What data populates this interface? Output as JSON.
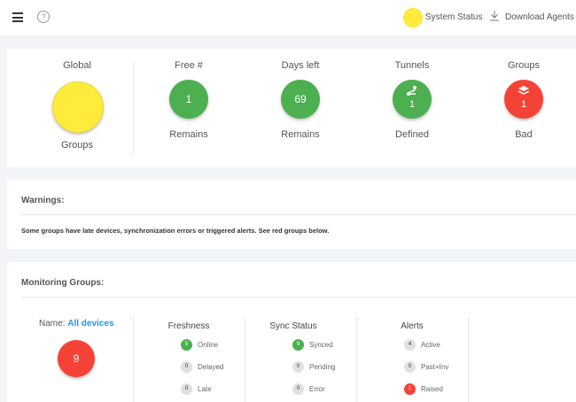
{
  "header": {
    "system_status_label": "System Status",
    "download_label": "Download Agents",
    "status_color": "#ffeb3b",
    "help_glyph": "?"
  },
  "summary": {
    "global": {
      "title": "Global",
      "footer": "Groups",
      "color": "#ffeb3b"
    },
    "free": {
      "title": "Free #",
      "value": "1",
      "footer": "Remains",
      "color": "#4caf50"
    },
    "days": {
      "title": "Days left",
      "value": "69",
      "footer": "Remains",
      "color": "#4caf50"
    },
    "tunnels": {
      "title": "Tunnels",
      "value": "1",
      "footer": "Defined",
      "color": "#4caf50",
      "icon": "route-icon"
    },
    "groups": {
      "title": "Groups",
      "value": "1",
      "footer": "Bad",
      "color": "#f44336",
      "icon": "layers-icon"
    }
  },
  "warnings": {
    "title": "Warnings:",
    "text": "Some groups have late devices, synchronization errors or triggered alerts. See red groups below."
  },
  "monitoring": {
    "title": "Monitoring Groups:",
    "name_label": "Name:",
    "name_value": "All devices",
    "group_count": "9",
    "freshness": {
      "title": "Freshness",
      "items": [
        {
          "count": "5",
          "label": "Online"
        },
        {
          "count": "0",
          "label": "Delayed"
        },
        {
          "count": "0",
          "label": "Late"
        }
      ]
    },
    "sync": {
      "title": "Sync Status",
      "items": [
        {
          "count": "9",
          "label": "Synced"
        },
        {
          "count": "0",
          "label": "Pending"
        },
        {
          "count": "0",
          "label": "Error"
        }
      ]
    },
    "alerts": {
      "title": "Alerts",
      "items": [
        {
          "count": "4",
          "label": "Active"
        },
        {
          "count": "0",
          "label": "Past+Inv"
        },
        {
          "count": "1",
          "label": "Raised"
        }
      ]
    }
  }
}
